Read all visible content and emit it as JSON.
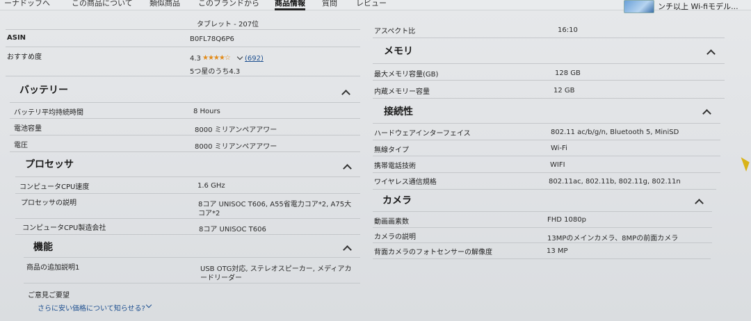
{
  "nav": {
    "items": [
      "ーナドッフへ",
      "この商品について",
      "類似商品",
      "このブランドから",
      "商品情報",
      "質問",
      "レビュー"
    ],
    "active": "商品情報",
    "promo_text": "ンチ以上 Wi-fiモデル..."
  },
  "left": {
    "rank_text": "タブレット - 207位",
    "asin_label": "ASIN",
    "asin_value": "B0FL78Q6P6",
    "rating_label": "おすすめ度",
    "rating_value": "4.3",
    "rating_stars": "★★★★☆",
    "rating_count": "(692)",
    "rating_sub": "5つ星のうち4.3",
    "battery": {
      "header": "バッテリー",
      "rows": [
        {
          "label": "バッテリ平均持続時間",
          "value": "8 Hours"
        },
        {
          "label": "電池容量",
          "value": "8000 ミリアンペアアワー"
        },
        {
          "label": "電圧",
          "value": "8000 ミリアンペアアワー"
        }
      ]
    },
    "processor": {
      "header": "プロセッサ",
      "rows": [
        {
          "label": "コンピュータCPU速度",
          "value": "1.6 GHz"
        },
        {
          "label": "プロセッサの説明",
          "value_line1": "8コア UNISOC T606, A55省電力コア*2, A75大",
          "value_line2": "コア*2"
        },
        {
          "label": "コンピュータCPU製造会社",
          "value": "8コア UNISOC T606"
        }
      ]
    },
    "features": {
      "header": "機能",
      "rows": [
        {
          "label": "商品の追加説明1",
          "value_line1": "USB OTG対応, ステレオスピーカー, メディアカ",
          "value_line2": "ードリーダー"
        }
      ]
    },
    "feedback": "ご意見ご要望",
    "price_link": "さらに安い価格について知らせる?"
  },
  "right": {
    "aspect": {
      "label": "アスペクト比",
      "value": "16:10"
    },
    "memory": {
      "header": "メモリ",
      "rows": [
        {
          "label": "最大メモリ容量(GB)",
          "value": "128 GB"
        },
        {
          "label": "内蔵メモリー容量",
          "value": "12 GB"
        }
      ]
    },
    "connectivity": {
      "header": "接続性",
      "rows": [
        {
          "label": "ハードウェアインターフェイス",
          "value": "802.11 ac/b/g/n, Bluetooth 5, MiniSD"
        },
        {
          "label": "無線タイプ",
          "value": "Wi-Fi"
        },
        {
          "label": "携帯電話技術",
          "value": "WIFI"
        },
        {
          "label": "ワイヤレス通信規格",
          "value": "802.11ac, 802.11b, 802.11g, 802.11n"
        }
      ]
    },
    "camera": {
      "header": "カメラ",
      "rows": [
        {
          "label": "動画画素数",
          "value": "FHD 1080p"
        },
        {
          "label": "カメラの説明",
          "value": "13MPのメインカメラ、8MPの前面カメラ"
        },
        {
          "label": "背面カメラのフォトセンサーの解像度",
          "value": "13 MP"
        }
      ]
    }
  }
}
